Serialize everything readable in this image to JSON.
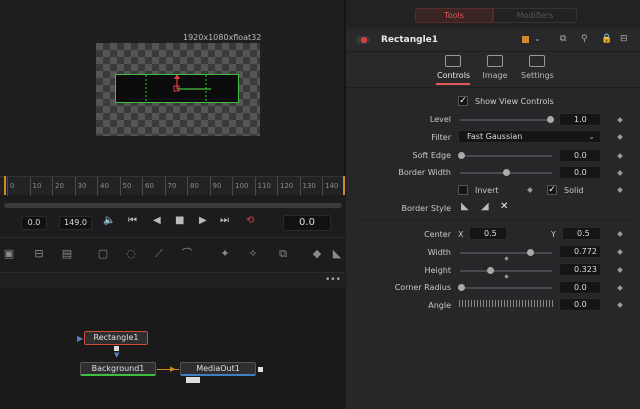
{
  "viewer": {
    "resolution_label": "1920x1080xfloat32"
  },
  "timeline": {
    "ruler_ticks": [
      "0",
      "10",
      "20",
      "30",
      "40",
      "50",
      "60",
      "70",
      "80",
      "90",
      "100",
      "110",
      "120",
      "130",
      "140"
    ],
    "current_frame": "0.0",
    "end_frame": "149.0",
    "right_time": "0.0"
  },
  "inspector": {
    "tabs": {
      "tools": "Tools",
      "modifiers": "Modifiers"
    },
    "node_name": "Rectangle1",
    "subtabs": {
      "controls": "Controls",
      "image": "Image",
      "settings": "Settings"
    },
    "show_view_controls_label": "Show View Controls",
    "params": {
      "level": {
        "label": "Level",
        "value": "1.0"
      },
      "filter": {
        "label": "Filter",
        "value": "Fast Gaussian"
      },
      "soft_edge": {
        "label": "Soft Edge",
        "value": "0.0"
      },
      "border_width": {
        "label": "Border Width",
        "value": "0.0"
      },
      "invert": {
        "label": "Invert"
      },
      "solid": {
        "label": "Solid"
      },
      "border_style": {
        "label": "Border Style"
      },
      "center": {
        "label": "Center",
        "x_label": "X",
        "x": "0.5",
        "y_label": "Y",
        "y": "0.5"
      },
      "width": {
        "label": "Width",
        "value": "0.772"
      },
      "height": {
        "label": "Height",
        "value": "0.323"
      },
      "corner_radius": {
        "label": "Corner Radius",
        "value": "0.0"
      },
      "angle": {
        "label": "Angle",
        "value": "0.0"
      }
    },
    "accent": "#e05a5a"
  },
  "nodes": {
    "rectangle": "Rectangle1",
    "background": "Background1",
    "media_out": "MediaOut1"
  },
  "icons": [
    "volume-icon",
    "skip-start-icon",
    "step-back-icon",
    "stop-icon",
    "play-icon",
    "skip-end-icon",
    "loop-icon",
    "pin-icon",
    "lock-icon",
    "collapse-icon",
    "dots-icon"
  ]
}
